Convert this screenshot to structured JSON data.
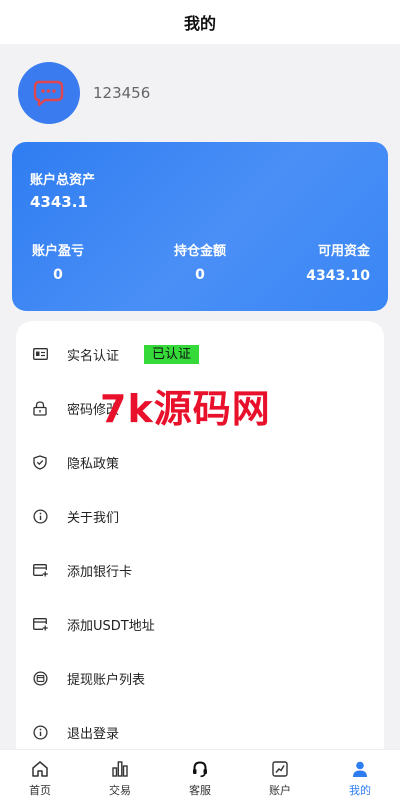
{
  "header": {
    "title": "我的"
  },
  "profile": {
    "username": "123456"
  },
  "assets": {
    "total_label": "账户总资产",
    "total_value": "4343.1",
    "pnl_label": "账户盈亏",
    "pnl_value": "0",
    "position_label": "持仓金额",
    "position_value": "0",
    "available_label": "可用资金",
    "available_value": "4343.10"
  },
  "menu": {
    "items": [
      {
        "label": "实名认证",
        "badge": "已认证",
        "icon": "id-card-icon"
      },
      {
        "label": "密码修改",
        "icon": "lock-icon"
      },
      {
        "label": "隐私政策",
        "icon": "shield-icon"
      },
      {
        "label": "关于我们",
        "icon": "info-icon"
      },
      {
        "label": "添加银行卡",
        "icon": "card-add-icon"
      },
      {
        "label": "添加USDT地址",
        "icon": "card-add-icon"
      },
      {
        "label": "提现账户列表",
        "icon": "wallet-list-icon"
      },
      {
        "label": "退出登录",
        "icon": "info-icon"
      }
    ]
  },
  "watermark": "7k源码网",
  "tabbar": {
    "items": [
      {
        "label": "首页",
        "icon": "home-icon"
      },
      {
        "label": "交易",
        "icon": "bar-chart-icon"
      },
      {
        "label": "客服",
        "icon": "headset-icon"
      },
      {
        "label": "账户",
        "icon": "chart-box-icon"
      },
      {
        "label": "我的",
        "icon": "user-icon",
        "active": true
      }
    ]
  },
  "colors": {
    "accent": "#2f7df2",
    "badge": "#35d93a",
    "watermark": "#e8102a"
  }
}
